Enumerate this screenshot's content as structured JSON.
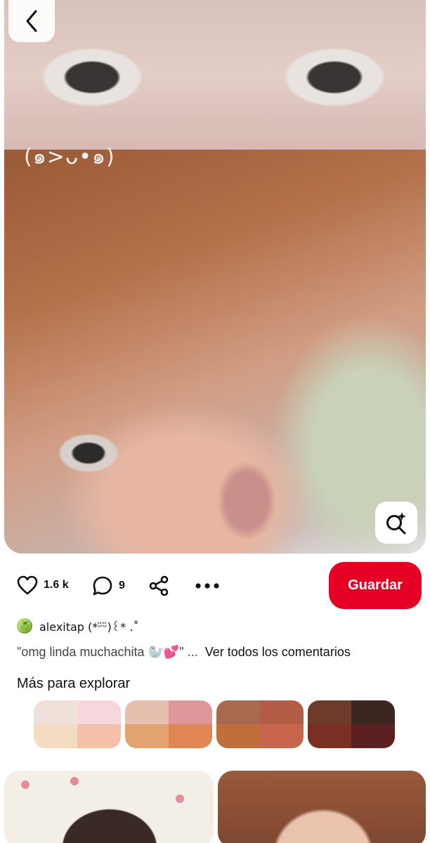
{
  "pin": {
    "overlay_text": "(๑>ᴗ•๑)"
  },
  "actions": {
    "likes": "1.6 k",
    "comments": "9",
    "save_label": "Guardar"
  },
  "author": {
    "avatar_emoji": "🍏",
    "name": "alexitap (*ᵕ̈ᵕ̈)꒰* .˚"
  },
  "comment": {
    "preview": "\"omg linda muchachita 🦭💕\" ...",
    "view_all_label": "Ver todos los comentarios"
  },
  "explore": {
    "title": "Más para explorar",
    "palettes": [
      [
        "#efe0da",
        "#f8d7dc",
        "#f4dcc2",
        "#f6bfa8"
      ],
      [
        "#e7bfae",
        "#e0979b",
        "#e3a36e",
        "#e08652"
      ],
      [
        "#a76a4f",
        "#b35d47",
        "#c06f3a",
        "#c7664d"
      ],
      [
        "#6e3b2a",
        "#3c2620",
        "#7b2f22",
        "#5c2022"
      ]
    ]
  },
  "colors": {
    "accent": "#e60023"
  },
  "icons": [
    "chevron-left-icon",
    "visual-search-icon",
    "heart-icon",
    "comment-icon",
    "share-icon",
    "more-icon"
  ]
}
